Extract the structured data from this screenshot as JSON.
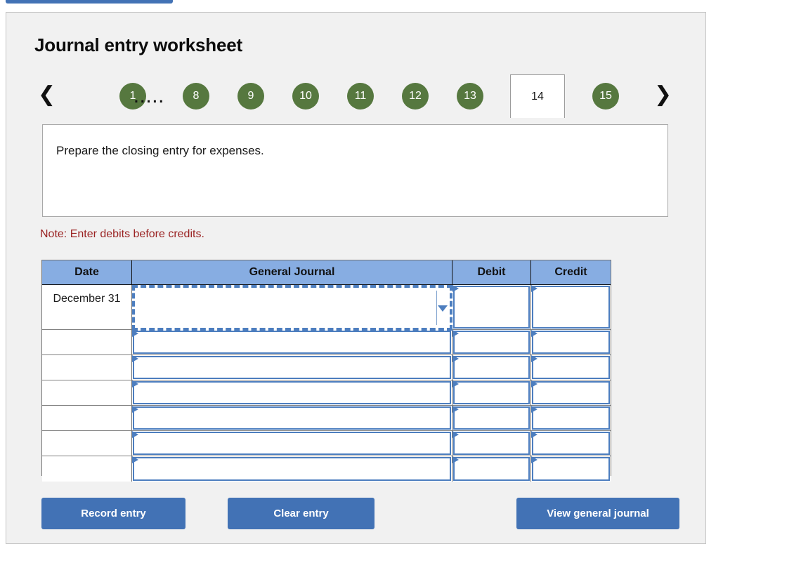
{
  "top_bar": {
    "name": "partial-blue-bar"
  },
  "panel": {
    "title": "Journal entry worksheet",
    "tabs": {
      "prev_icon": "❮",
      "next_icon": "❯",
      "ellipsis": ".....",
      "items": [
        {
          "label": "1",
          "active": false
        },
        {
          "label": "8",
          "active": false
        },
        {
          "label": "9",
          "active": false
        },
        {
          "label": "10",
          "active": false
        },
        {
          "label": "11",
          "active": false
        },
        {
          "label": "12",
          "active": false
        },
        {
          "label": "13",
          "active": false
        },
        {
          "label": "14",
          "active": true
        },
        {
          "label": "15",
          "active": false
        }
      ]
    },
    "prompt": "Prepare the closing entry for expenses.",
    "note": "Note: Enter debits before credits.",
    "table": {
      "headers": [
        "Date",
        "General Journal",
        "Debit",
        "Credit"
      ],
      "rows": [
        {
          "date": "December 31",
          "general_journal": "",
          "debit": "",
          "credit": "",
          "focused": true
        },
        {
          "date": "",
          "general_journal": "",
          "debit": "",
          "credit": "",
          "focused": false
        },
        {
          "date": "",
          "general_journal": "",
          "debit": "",
          "credit": "",
          "focused": false
        },
        {
          "date": "",
          "general_journal": "",
          "debit": "",
          "credit": "",
          "focused": false
        },
        {
          "date": "",
          "general_journal": "",
          "debit": "",
          "credit": "",
          "focused": false
        },
        {
          "date": "",
          "general_journal": "",
          "debit": "",
          "credit": "",
          "focused": false
        },
        {
          "date": "",
          "general_journal": "",
          "debit": "",
          "credit": "",
          "focused": false
        }
      ]
    },
    "buttons": {
      "record": "Record entry",
      "clear": "Clear entry",
      "view": "View general journal"
    }
  },
  "colors": {
    "tab_green": "#56783f",
    "table_header_blue": "#87ade2",
    "button_blue": "#4272b5",
    "field_border_blue": "#4d7ebf",
    "note_red": "#9a2222",
    "panel_bg": "#f1f1f1"
  }
}
